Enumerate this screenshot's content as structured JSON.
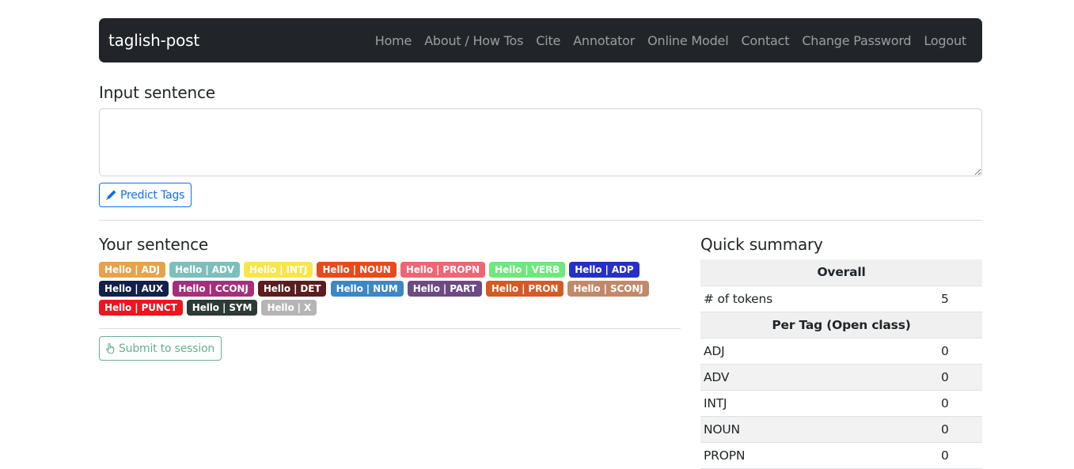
{
  "navbar": {
    "brand": "taglish-post",
    "links": [
      "Home",
      "About / How Tos",
      "Cite",
      "Annotator",
      "Online Model",
      "Contact",
      "Change Password",
      "Logout"
    ]
  },
  "input": {
    "title": "Input sentence",
    "value": "",
    "predict_button": "Predict Tags"
  },
  "sentence": {
    "title": "Your sentence",
    "tags": [
      {
        "label": "Hello | ADJ",
        "color": "#e9a24a"
      },
      {
        "label": "Hello | ADV",
        "color": "#7cbfbb"
      },
      {
        "label": "Hello | INTJ",
        "color": "#f9e54a"
      },
      {
        "label": "Hello | NOUN",
        "color": "#e84a1b"
      },
      {
        "label": "Hello | PROPN",
        "color": "#f06473"
      },
      {
        "label": "Hello | VERB",
        "color": "#6ee87a"
      },
      {
        "label": "Hello | ADP",
        "color": "#2630c8"
      },
      {
        "label": "Hello | AUX",
        "color": "#13214a"
      },
      {
        "label": "Hello | CCONJ",
        "color": "#a4307a"
      },
      {
        "label": "Hello | DET",
        "color": "#5a1e1e"
      },
      {
        "label": "Hello | NUM",
        "color": "#3d87c4"
      },
      {
        "label": "Hello | PART",
        "color": "#6c4a82"
      },
      {
        "label": "Hello | PRON",
        "color": "#d65a24"
      },
      {
        "label": "Hello | SCONJ",
        "color": "#c08a6a"
      },
      {
        "label": "Hello | PUNCT",
        "color": "#f0141e"
      },
      {
        "label": "Hello | SYM",
        "color": "#2e3a36"
      },
      {
        "label": "Hello | X",
        "color": "#b5b5b5"
      }
    ],
    "submit_button": "Submit to session"
  },
  "summary": {
    "title": "Quick summary",
    "overall_header": "Overall",
    "tokens_label": "# of tokens",
    "tokens_value": "5",
    "per_tag_header": "Per Tag (Open class)",
    "per_tag": [
      {
        "tag": "ADJ",
        "count": "0"
      },
      {
        "tag": "ADV",
        "count": "0"
      },
      {
        "tag": "INTJ",
        "count": "0"
      },
      {
        "tag": "NOUN",
        "count": "0"
      },
      {
        "tag": "PROPN",
        "count": "0"
      }
    ]
  },
  "icons": {
    "predict": "pen-icon",
    "submit": "hand-pointer-icon"
  },
  "colors": {
    "navbar_bg": "#212529",
    "primary": "#0d6efd",
    "success": "#198754"
  }
}
